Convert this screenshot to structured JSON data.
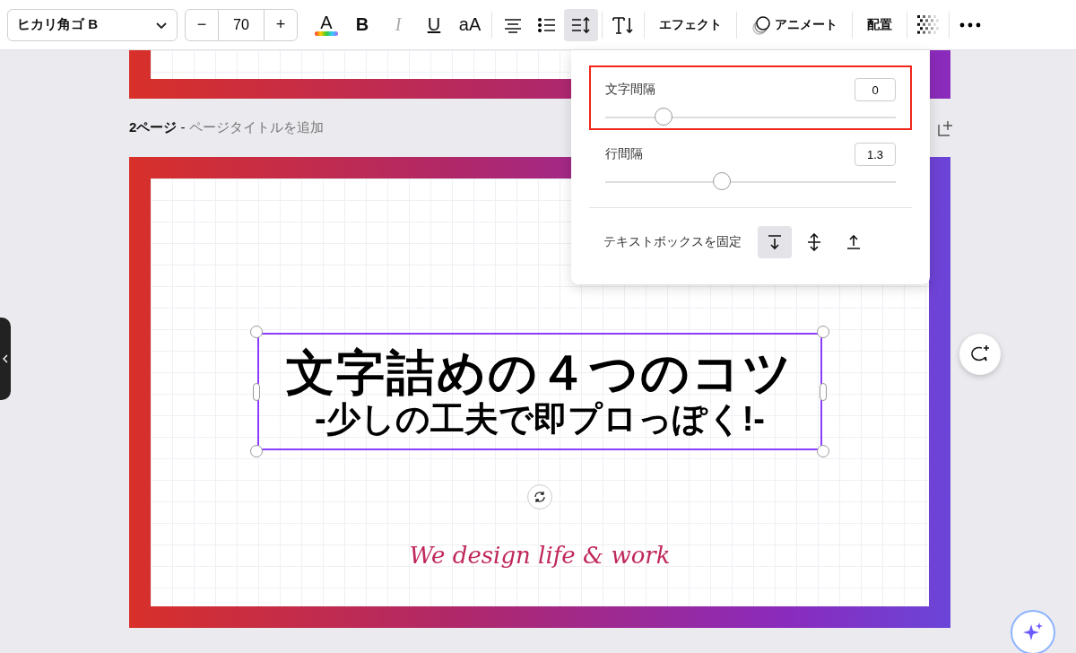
{
  "toolbar": {
    "font_name": "ヒカリ角ゴ B",
    "font_size": "70",
    "decrease": "−",
    "increase": "+",
    "text_color_letter": "A",
    "style_buttons": [
      {
        "kind": "bold",
        "label": "B"
      },
      {
        "kind": "italic",
        "label": "I"
      },
      {
        "kind": "underline",
        "label": "U"
      },
      {
        "kind": "case",
        "label": "aA"
      }
    ],
    "spacing_selected": true,
    "effects": "エフェクト",
    "animate": "アニメート",
    "position": "配置"
  },
  "spacing_panel": {
    "letter_spacing": {
      "label": "文字間隔",
      "value": "0",
      "level": 0.2,
      "highlighted": true
    },
    "line_spacing": {
      "label": "行間隔",
      "value": "1.3",
      "level": 0.4
    },
    "anchor": {
      "label": "テキストボックスを固定",
      "options": [
        {
          "kind": "top",
          "selected": true
        },
        {
          "kind": "middle",
          "selected": false
        },
        {
          "kind": "bottom",
          "selected": false
        }
      ]
    }
  },
  "page": {
    "label": "2ページ",
    "separator": "-",
    "title_placeholder": "ページタイトルを追加",
    "heading": "文字詰めの４つのコツ",
    "subheading": "-少しの工夫で即プロっぽく!-",
    "tagline": "We design life & work"
  }
}
